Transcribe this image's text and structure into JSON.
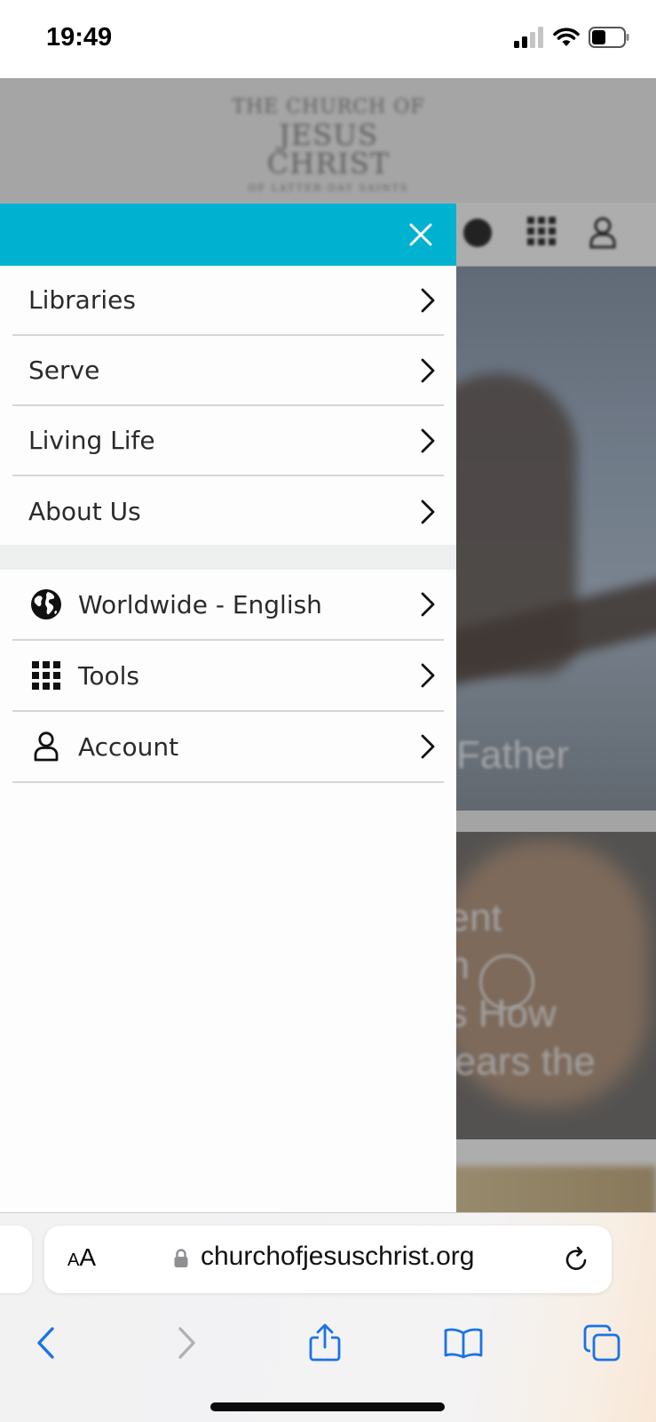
{
  "status_bar": {
    "time": "19:49"
  },
  "background_page": {
    "logo": {
      "line1": "THE CHURCH OF",
      "line2": "JESUS CHRIST",
      "line3": "OF LATTER-DAY SAINTS"
    },
    "hero_text": "ly Father",
    "card_text": [
      "dent",
      "on",
      "es How",
      "Hears the"
    ]
  },
  "drawer": {
    "header_color": "#00b2cf",
    "close_icon": "close-icon",
    "primary_items": [
      {
        "label": "Libraries"
      },
      {
        "label": "Serve"
      },
      {
        "label": "Living Life"
      },
      {
        "label": "About Us"
      }
    ],
    "secondary_items": [
      {
        "icon": "globe-icon",
        "label": "Worldwide - English"
      },
      {
        "icon": "grid-icon",
        "label": "Tools"
      },
      {
        "icon": "person-icon",
        "label": "Account"
      }
    ]
  },
  "browser": {
    "text_size_label_small": "A",
    "text_size_label_big": "A",
    "url": "churchofjesuschrist.org",
    "accent_color": "#1a73e8"
  }
}
